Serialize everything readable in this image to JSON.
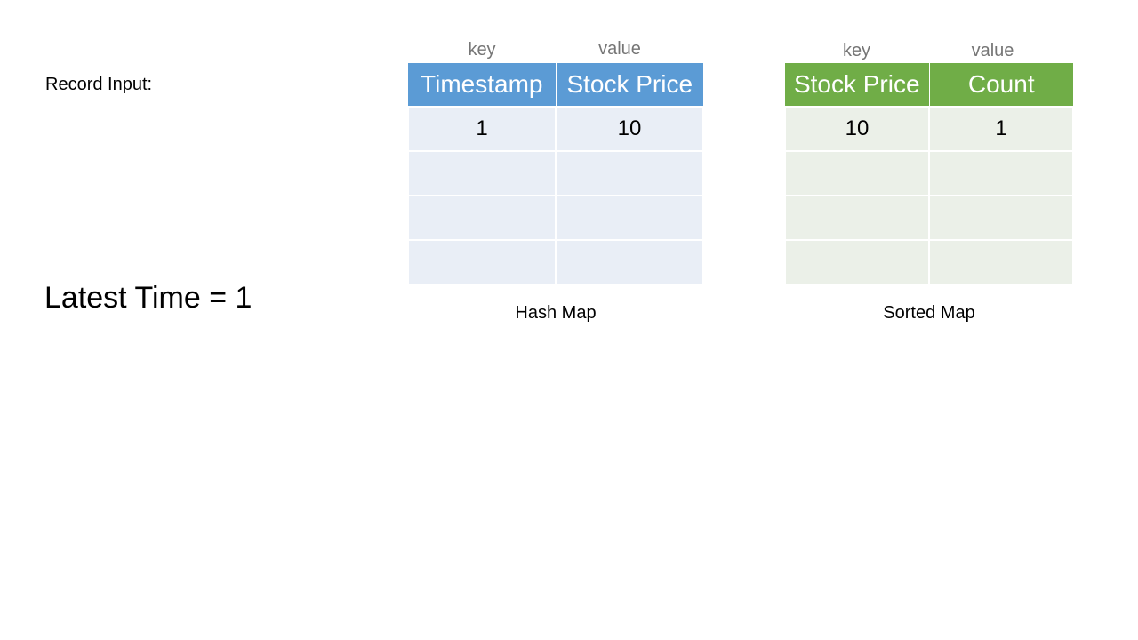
{
  "record_input_label": "Record Input:",
  "latest_time_label": "Latest Time = 1",
  "hash_map": {
    "key_label": "key",
    "value_label": "value",
    "columns": [
      "Timestamp",
      "Stock Price"
    ],
    "rows": [
      [
        "1",
        "10"
      ],
      [
        "",
        ""
      ],
      [
        "",
        ""
      ],
      [
        "",
        ""
      ]
    ],
    "caption": "Hash Map",
    "header_color": "#5b9bd5",
    "cell_color": "#e9eef6"
  },
  "sorted_map": {
    "key_label": "key",
    "value_label": "value",
    "columns": [
      "Stock Price",
      "Count"
    ],
    "rows": [
      [
        "10",
        "1"
      ],
      [
        "",
        ""
      ],
      [
        "",
        ""
      ],
      [
        "",
        ""
      ]
    ],
    "caption": "Sorted Map",
    "header_color": "#70ad47",
    "cell_color": "#ebf0e8"
  }
}
